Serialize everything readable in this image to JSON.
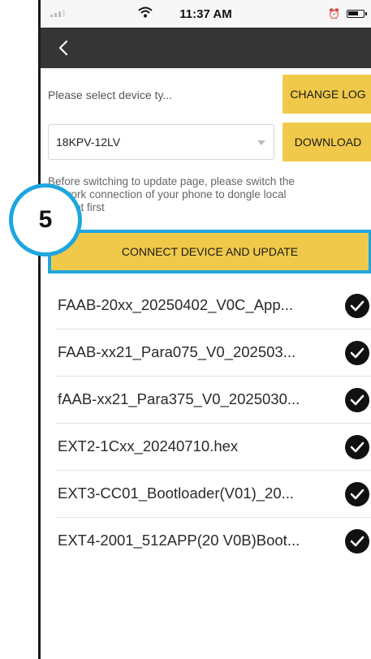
{
  "status_bar": {
    "time": "11:37 AM",
    "icons": [
      "signal-icon",
      "wifi-icon",
      "alarm-icon",
      "battery-icon"
    ]
  },
  "nav": {
    "back_icon": "chevron-left-icon"
  },
  "device_select": {
    "label": "Please select device ty...",
    "selected_value": "18KPV-12LV"
  },
  "buttons": {
    "change_log": "CHANGE LOG",
    "download": "DOWNLOAD",
    "connect_update": "CONNECT DEVICE AND UPDATE"
  },
  "notice": {
    "line1": "Before switching to update page, please switch the",
    "line2": "network connection of your phone to dongle local",
    "line3": "hotspot first"
  },
  "step_badge": "5",
  "files": [
    {
      "name": "FAAB-20xx_20250402_V0C_App...",
      "checked": true
    },
    {
      "name": "FAAB-xx21_Para075_V0_202503...",
      "checked": true
    },
    {
      "name": "fAAB-xx21_Para375_V0_2025030...",
      "checked": true
    },
    {
      "name": "EXT2-1Cxx_20240710.hex",
      "checked": true
    },
    {
      "name": "EXT3-CC01_Bootloader(V01)_20...",
      "checked": true
    },
    {
      "name": "EXT4-2001_512APP(20 V0B)Boot...",
      "checked": true
    }
  ],
  "colors": {
    "accent_yellow": "#f0c94a",
    "highlight_blue": "#1fa6df",
    "nav_bar": "#353535"
  }
}
